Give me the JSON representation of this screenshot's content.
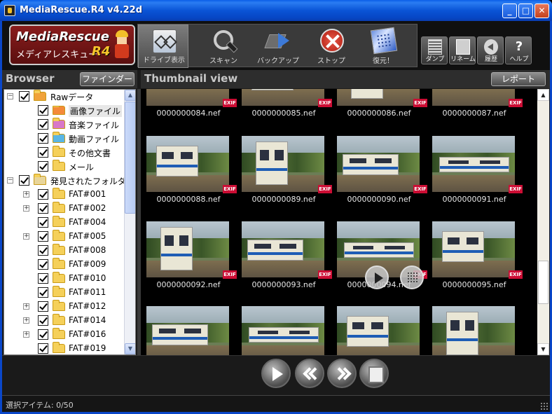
{
  "window": {
    "title": "MediaRescue.R4 v4.22d",
    "minimize": "_",
    "maximize": "□",
    "close": "✕"
  },
  "logo": {
    "main": "MediaRescue",
    "sub": "メディアレスキュー",
    "suffix": "R4"
  },
  "toolbar": {
    "main_buttons": [
      {
        "label": "ドライブ表示",
        "icon": "drive-view-icon"
      },
      {
        "label": "スキャン",
        "icon": "magnifier-icon"
      },
      {
        "label": "バックアップ",
        "icon": "backup-arrow-icon"
      },
      {
        "label": "ストップ",
        "icon": "stop-icon"
      },
      {
        "label": "復元！",
        "icon": "restore-icon"
      }
    ],
    "small_buttons": [
      {
        "label": "ダンプ",
        "icon": "dump-icon"
      },
      {
        "label": "リネーム",
        "icon": "rename-icon"
      },
      {
        "label": "履歴",
        "icon": "history-icon"
      },
      {
        "label": "ヘルプ",
        "icon": "help-icon",
        "glyph": "?"
      }
    ]
  },
  "browser": {
    "title": "Browser",
    "finder_label": "ファインダー",
    "tree": [
      {
        "label": "Rawデータ",
        "level": 0,
        "expander": "−",
        "icon": "open-folder"
      },
      {
        "label": "画像ファイル",
        "level": 1,
        "icon": "photo-folder",
        "selected": true
      },
      {
        "label": "音楽ファイル",
        "level": 1,
        "icon": "music-folder"
      },
      {
        "label": "動画ファイル",
        "level": 1,
        "icon": "video-folder"
      },
      {
        "label": "その他文書",
        "level": 1,
        "icon": "folder"
      },
      {
        "label": "メール",
        "level": 1,
        "icon": "folder"
      },
      {
        "label": "発見されたフォルダ",
        "level": 0,
        "expander": "−",
        "icon": "found-folder"
      },
      {
        "label": "FAT#001",
        "level": 1,
        "expander": "+",
        "icon": "folder"
      },
      {
        "label": "FAT#002",
        "level": 1,
        "expander": "+",
        "icon": "folder"
      },
      {
        "label": "FAT#004",
        "level": 1,
        "icon": "folder"
      },
      {
        "label": "FAT#005",
        "level": 1,
        "expander": "+",
        "icon": "folder"
      },
      {
        "label": "FAT#008",
        "level": 1,
        "icon": "folder"
      },
      {
        "label": "FAT#009",
        "level": 1,
        "icon": "folder"
      },
      {
        "label": "FAT#010",
        "level": 1,
        "icon": "folder"
      },
      {
        "label": "FAT#011",
        "level": 1,
        "icon": "folder"
      },
      {
        "label": "FAT#012",
        "level": 1,
        "expander": "+",
        "icon": "folder"
      },
      {
        "label": "FAT#014",
        "level": 1,
        "expander": "+",
        "icon": "folder"
      },
      {
        "label": "FAT#016",
        "level": 1,
        "expander": "+",
        "icon": "folder"
      },
      {
        "label": "FAT#019",
        "level": 1,
        "icon": "folder"
      }
    ]
  },
  "thumbnail_view": {
    "title": "Thumbnail view",
    "report_label": "レポート",
    "badge": "EXIF",
    "rows": [
      [
        "0000000084.nef",
        "0000000085.nef",
        "0000000086.nef",
        "0000000087.nef"
      ],
      [
        "0000000088.nef",
        "0000000089.nef",
        "0000000090.nef",
        "0000000091.nef"
      ],
      [
        "0000000092.nef",
        "0000000093.nef",
        "0000000094.nef",
        "0000000095.nef"
      ],
      [
        "",
        "",
        "",
        ""
      ]
    ]
  },
  "status": {
    "selected_items": "選択アイテム: 0/50"
  }
}
